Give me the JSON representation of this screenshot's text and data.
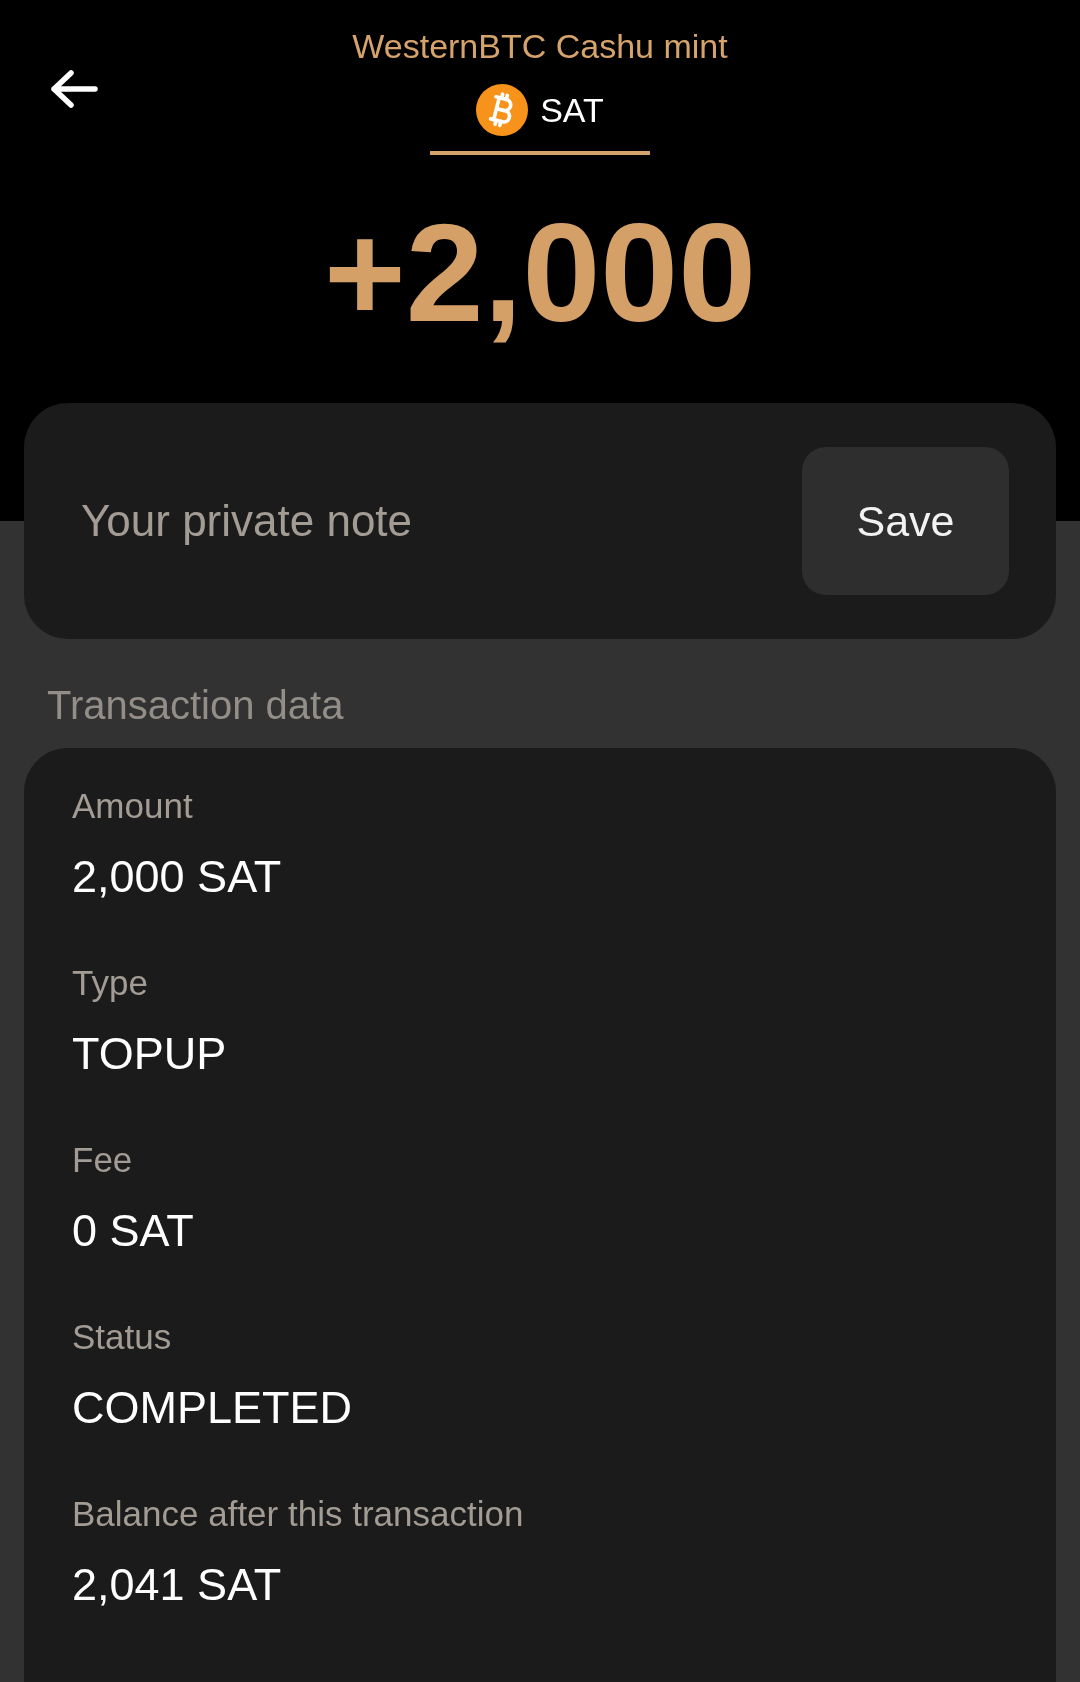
{
  "header": {
    "mint_name": "WesternBTC Cashu mint",
    "units": [
      {
        "label": "SAT",
        "selected": true
      }
    ],
    "amount": "+2,000"
  },
  "note": {
    "placeholder": "Your private note",
    "button": "Save"
  },
  "section_title": "Transaction data",
  "details": [
    {
      "label": "Amount",
      "value": "2,000 SAT"
    },
    {
      "label": "Type",
      "value": "TOPUP"
    },
    {
      "label": "Fee",
      "value": "0 SAT"
    },
    {
      "label": "Status",
      "value": "COMPLETED"
    },
    {
      "label": "Balance after this transaction",
      "value": "2,041 SAT"
    }
  ]
}
